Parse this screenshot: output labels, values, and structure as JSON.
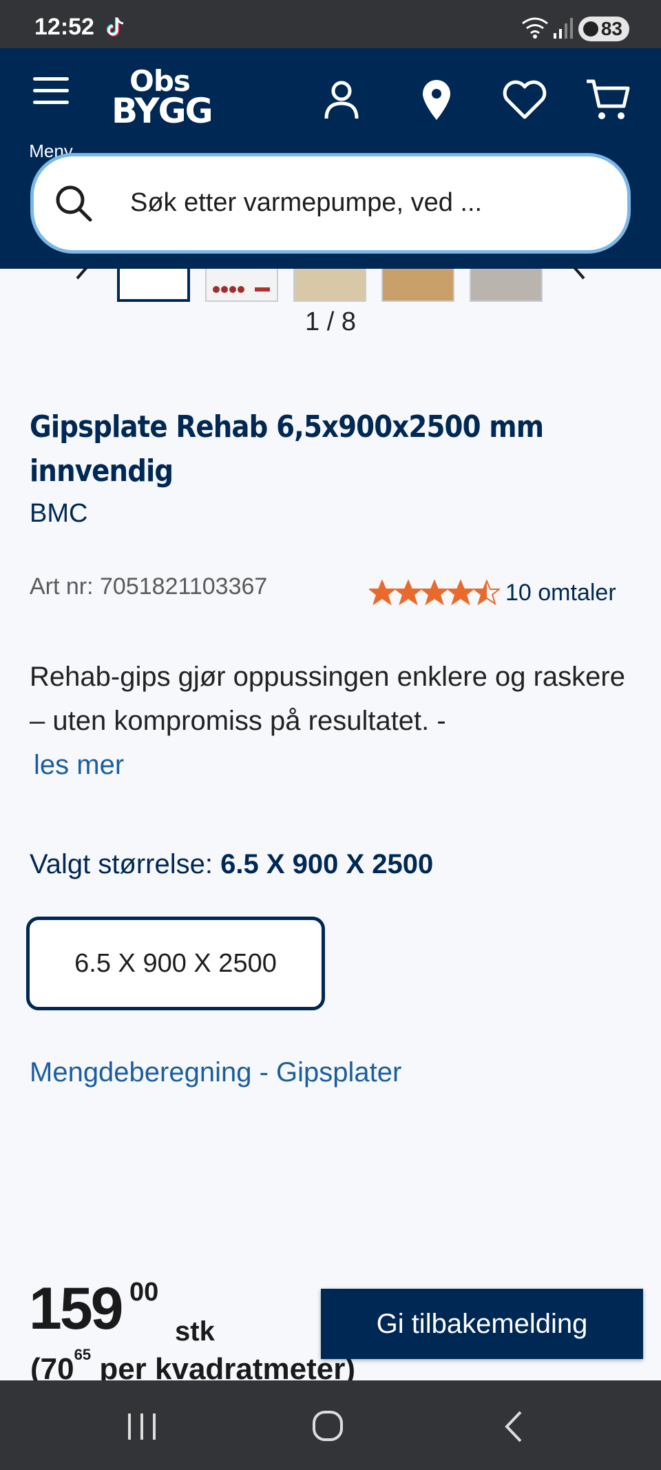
{
  "status_bar": {
    "time": "12:52",
    "battery": "83"
  },
  "header": {
    "menu_label": "Meny",
    "logo_line1": "Obs",
    "logo_line2": "BYGG",
    "search_placeholder": "Søk etter varmepumpe, ved ..."
  },
  "gallery": {
    "counter": "1 / 8",
    "thumbnail_count": 5,
    "active_index": 0
  },
  "product": {
    "title": "Gipsplate Rehab 6,5x900x2500 mm innvendig",
    "brand": "BMC",
    "art_nr": "Art nr: 7051821103367",
    "rating": 4.5,
    "reviews": "10 omtaler",
    "description": "Rehab-gips gjør oppussingen enklere og raskere – uten kompromiss på resultatet. -",
    "read_more": "les mer",
    "size_label": "Valgt størrelse:",
    "size_selected": "6.5 X 900 X 2500",
    "size_option": "6.5 X 900 X 2500",
    "calc_link": "Mengdeberegning - Gipsplater"
  },
  "price": {
    "integer": "159",
    "decimals": "00",
    "unit": "stk",
    "per_open": "(70",
    "per_decimals": "65",
    "per_rest": "per kvadratmeter)"
  },
  "feedback_button": "Gi tilbakemelding",
  "colors": {
    "brand_navy": "#002855",
    "link_blue": "#1b5e9e",
    "star_orange": "#e86a2c"
  }
}
